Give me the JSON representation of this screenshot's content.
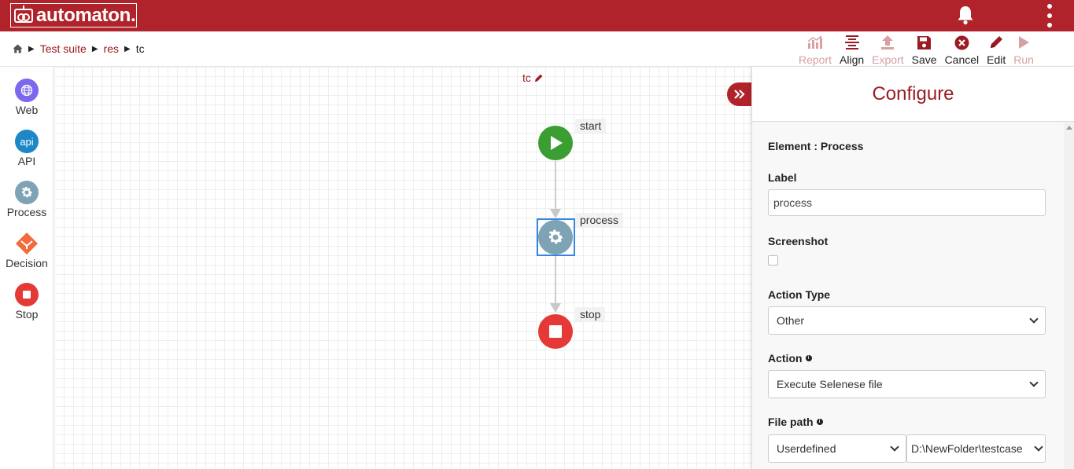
{
  "header": {
    "logo_text": "automaton.",
    "icons": {
      "notifications": "bell-icon",
      "menu": "kebab-menu-icon"
    },
    "brand_color": "#b0232a"
  },
  "breadcrumb": {
    "home_icon": "home-icon",
    "items": [
      "Test suite",
      "res",
      "tc"
    ]
  },
  "toolbar": {
    "report": "Report",
    "align": "Align",
    "export": "Export",
    "save": "Save",
    "cancel": "Cancel",
    "edit": "Edit",
    "run": "Run"
  },
  "palette": {
    "items": [
      {
        "label": "Web",
        "icon": "globe-icon",
        "color": "#7b68ee"
      },
      {
        "label": "API",
        "icon_text": "api",
        "color": "#1e88c7"
      },
      {
        "label": "Process",
        "icon": "gear-icon",
        "color": "#7ea3b5"
      },
      {
        "label": "Decision",
        "icon": "decision-icon",
        "color": "#f26b3a"
      },
      {
        "label": "Stop",
        "icon": "stop-icon",
        "color": "#e53935"
      }
    ]
  },
  "canvas": {
    "title": "tc",
    "nodes": {
      "start": "start",
      "process": "process",
      "stop": "stop"
    }
  },
  "configure": {
    "title": "Configure",
    "element": "Element : Process",
    "label_field": {
      "label": "Label",
      "value": "process"
    },
    "screenshot": {
      "label": "Screenshot",
      "checked": false
    },
    "action_type": {
      "label": "Action Type",
      "value": "Other"
    },
    "action": {
      "label": "Action",
      "value": "Execute Selenese file"
    },
    "file_path": {
      "label": "File path",
      "source": "Userdefined",
      "value": "D:\\NewFolder\\testcase"
    }
  }
}
